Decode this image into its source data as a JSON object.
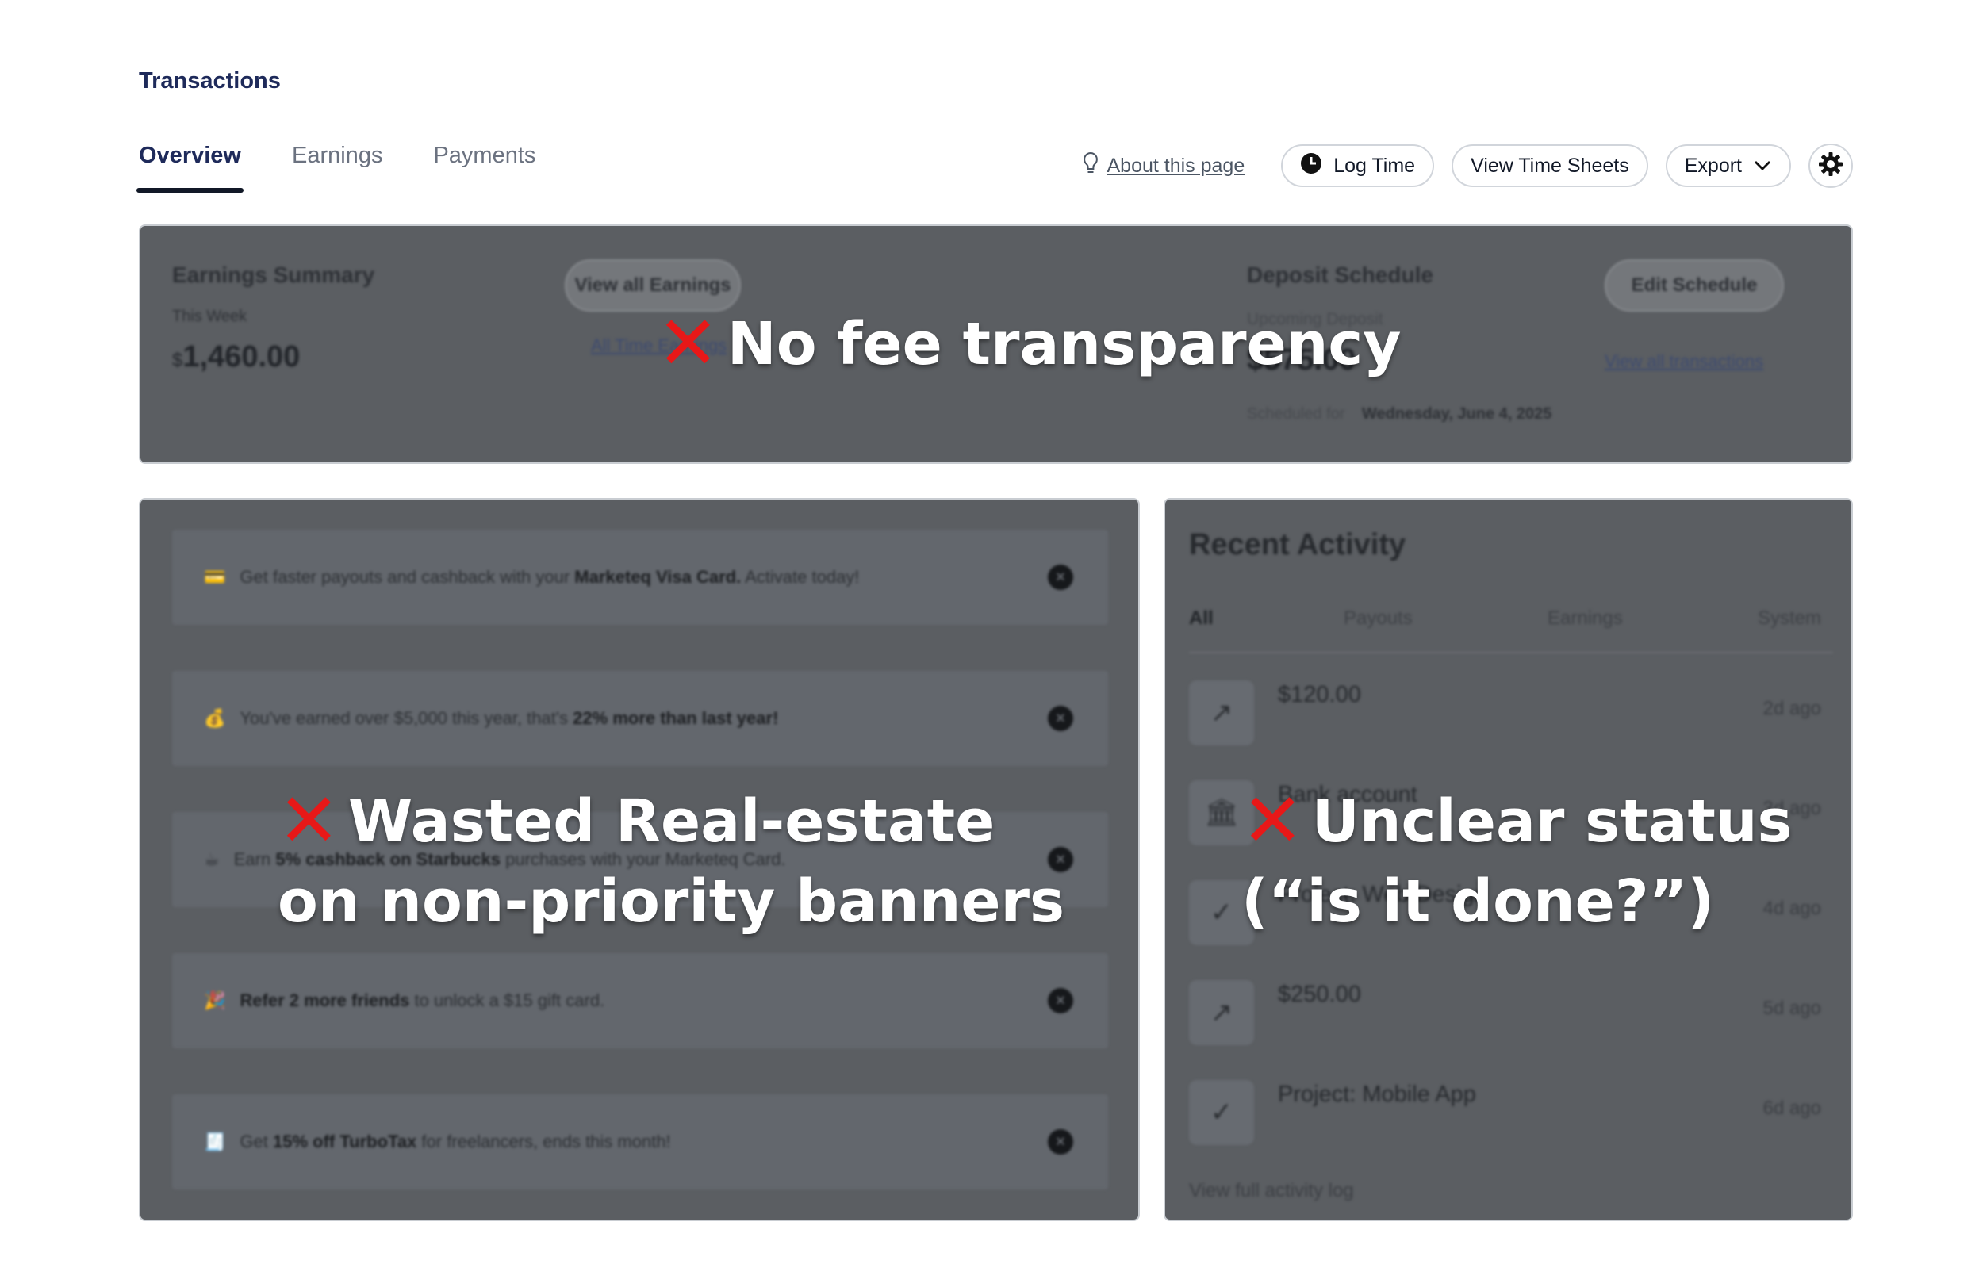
{
  "page": {
    "title": "Transactions"
  },
  "tabs": [
    {
      "label": "Overview",
      "active": true
    },
    {
      "label": "Earnings",
      "active": false
    },
    {
      "label": "Payments",
      "active": false
    }
  ],
  "toolbar": {
    "about_label": "About this page",
    "about_icon": "lightbulb-icon",
    "log_time_label": "Log Time",
    "log_time_icon": "clock-icon",
    "view_time_sheets_label": "View Time Sheets",
    "export_label": "Export",
    "export_icon": "chevron-down-icon",
    "settings_icon": "gear-icon"
  },
  "earnings_summary": {
    "title": "Earnings Summary",
    "period": "This Week",
    "currency_symbol": "$",
    "amount": "1,460.00",
    "view_all_button": "View all Earnings",
    "link": "All Time Earnings"
  },
  "deposit_schedule": {
    "title": "Deposit Schedule",
    "subtitle": "Upcoming Deposit",
    "amount": "$575.00",
    "date_label": "Scheduled for",
    "date": "Wednesday, June 4, 2025",
    "edit_button": "Edit Schedule",
    "link": "View all transactions"
  },
  "banners": [
    {
      "icon": "💳",
      "pre": "Get faster payouts and cashback with your ",
      "bold": "Marketeq Visa Card.",
      "post": " Activate today!"
    },
    {
      "icon": "💰",
      "pre": "You've earned over $5,000 this year, that's ",
      "bold": "22% more than last year!",
      "post": ""
    },
    {
      "icon": "☕",
      "pre": "Earn ",
      "bold": "5% cashback on Starbucks",
      "post": " purchases with your Marketeq Card."
    },
    {
      "icon": "🎉",
      "pre": "",
      "bold": "Refer 2 more friends",
      "post": " to unlock a $15 gift card."
    },
    {
      "icon": "🧾",
      "pre": "Get ",
      "bold": "15% off TurboTax",
      "post": " for freelancers, ends this month!"
    }
  ],
  "recent_activity": {
    "title": "Recent Activity",
    "tabs": [
      "All",
      "Payouts",
      "Earnings",
      "System"
    ],
    "items": [
      {
        "icon": "arrow-up-right-icon",
        "glyph": "↗",
        "text": "$120.00",
        "time": "2d ago"
      },
      {
        "icon": "bank-icon",
        "glyph": "🏛",
        "text": "Bank account",
        "time": "3d ago"
      },
      {
        "icon": "check-circle-icon",
        "glyph": "✓",
        "text": "Project: Web Design",
        "time": "4d ago"
      },
      {
        "icon": "arrow-up-right-icon",
        "glyph": "↗",
        "text": "$250.00",
        "time": "5d ago"
      },
      {
        "icon": "check-circle-icon",
        "glyph": "✓",
        "text": "Project: Mobile App",
        "time": "6d ago"
      }
    ],
    "footer_link": "View full activity log"
  },
  "annotations": {
    "fee": "No fee transparency",
    "banners_line1": "Wasted Real-estate",
    "banners_line2": "on non-priority banners",
    "status_line1": "Unclear status",
    "status_line2": "(“is it done?”)",
    "mark": "✕",
    "mark_color": "#e81818"
  }
}
